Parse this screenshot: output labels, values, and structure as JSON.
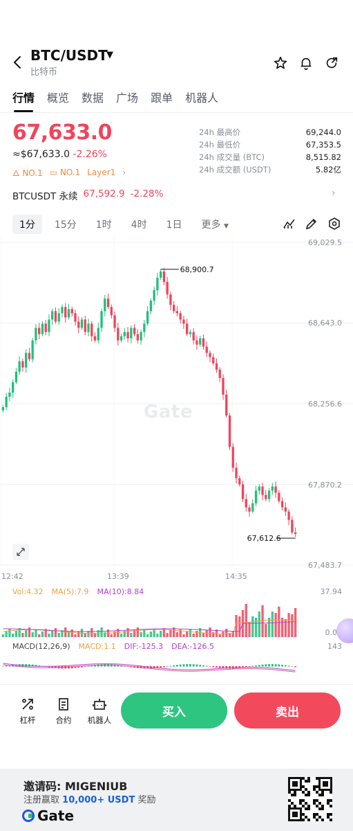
{
  "header": {
    "pair": "BTC/USDT",
    "subtitle": "比特币",
    "icons": [
      "back-icon",
      "star-icon",
      "bell-icon",
      "share-icon"
    ]
  },
  "tabs": [
    "行情",
    "概览",
    "数据",
    "广场",
    "跟单",
    "机器人"
  ],
  "price": {
    "last": "67,633.0",
    "approx": "≈$67,633.0",
    "change": "-2.26%",
    "badge1": "NO.1",
    "badge2": "NO.1",
    "badge3": "Layer1"
  },
  "stats": [
    {
      "k": "24h 最高价",
      "v": "69,244.0"
    },
    {
      "k": "24h 最低价",
      "v": "67,353.5"
    },
    {
      "k": "24h 成交量 (BTC)",
      "v": "8,515.82"
    },
    {
      "k": "24h 成交额 (USDT)",
      "v": "5.82亿"
    }
  ],
  "perpetual": {
    "name": "BTCUSDT 永续",
    "price": "67,592.9",
    "change": "-2.28%"
  },
  "timeframes": [
    "1分",
    "15分",
    "1时",
    "4时",
    "1日",
    "更多"
  ],
  "chart": {
    "price_axis": [
      "69,029.5",
      "68,643.0",
      "68,256.6",
      "67,870.2",
      "67,483.7"
    ],
    "time_axis": [
      "12:42",
      "13:39",
      "14:35"
    ],
    "high_marker": "68,900.7",
    "low_marker": "67,612.6",
    "watermark": "Gate"
  },
  "volume": {
    "vol": "Vol:4.32",
    "ma5": "MA(5):7.9",
    "ma10": "MA(10):8.84",
    "axis_top": "37.94",
    "axis_bottom": "0.00"
  },
  "macd": {
    "label": "MACD(12,26,9)",
    "macd": "MACD:1.1",
    "dif": "DIF:-125.3",
    "dea": "DEA:-126.5",
    "axis": "143"
  },
  "tools": [
    {
      "label": "杠杆",
      "icon": "leverage-icon"
    },
    {
      "label": "合约",
      "icon": "contract-icon"
    },
    {
      "label": "机器人",
      "icon": "robot-icon"
    }
  ],
  "actions": {
    "buy": "买入",
    "sell": "卖出"
  },
  "footer": {
    "invite": "邀请码: MIGENIUB",
    "promo_prefix": "注册赢取",
    "promo_amount": "10,000+ USDT",
    "promo_suffix": "奖励",
    "brand": "Gate"
  },
  "colors": {
    "up": "#21c07a",
    "down": "#f0445b",
    "buy": "#2ec581",
    "sell": "#f24a5c"
  },
  "chart_data": {
    "type": "candlestick",
    "y_range": [
      67483.7,
      69029.5
    ],
    "y_ticks": [
      69029.5,
      68643.0,
      68256.6,
      67870.2,
      67483.7
    ],
    "x_ticks": [
      "12:42",
      "13:39",
      "14:35"
    ],
    "max_marker": 68900.7,
    "min_marker": 67612.6,
    "closes": [
      68240,
      68290,
      68310,
      68360,
      68410,
      68460,
      68430,
      68500,
      68470,
      68560,
      68620,
      68590,
      68640,
      68600,
      68660,
      68700,
      68650,
      68690,
      68720,
      68670,
      68710,
      68690,
      68650,
      68620,
      68660,
      68600,
      68640,
      68580,
      68560,
      68620,
      68700,
      68760,
      68720,
      68680,
      68620,
      68560,
      68580,
      68600,
      68570,
      68620,
      68590,
      68560,
      68600,
      68640,
      68700,
      68750,
      68800,
      68860,
      68890,
      68840,
      68780,
      68730,
      68700,
      68690,
      68660,
      68640,
      68590,
      68600,
      68560,
      68540,
      68570,
      68530,
      68500,
      68480,
      68450,
      68420,
      68380,
      68300,
      68200,
      68050,
      67950,
      67900,
      67870,
      67800,
      67760,
      67740,
      67780,
      67840,
      67860,
      67820,
      67800,
      67840,
      67860,
      67830,
      67790,
      67760,
      67740,
      67700,
      67640,
      67633
    ]
  }
}
